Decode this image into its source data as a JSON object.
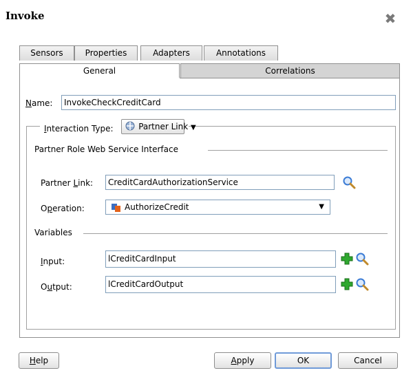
{
  "window": {
    "title": "Invoke",
    "close_icon": "close-icon"
  },
  "tabs": {
    "back": [
      {
        "label": "Sensors"
      },
      {
        "label": "Properties"
      },
      {
        "label": "Adapters"
      },
      {
        "label": "Annotations"
      }
    ],
    "front": [
      {
        "label": "General",
        "selected": true
      },
      {
        "label": "Correlations",
        "selected": false
      }
    ]
  },
  "form": {
    "name_label": "Name:",
    "name_label_mnemonic": "N",
    "name_label_rest": "ame:",
    "name_value": "InvokeCheckCreditCard",
    "interaction_label": "Interaction Type:",
    "interaction_label_mnemonic": "I",
    "interaction_label_rest": "nteraction Type:",
    "interaction_value": "Partner Link",
    "partner_role_section": "Partner Role Web Service Interface",
    "partner_link_label": "Partner Link:",
    "partner_link_pre": "Partner ",
    "partner_link_mnemonic": "L",
    "partner_link_rest": "ink:",
    "partner_link_value": "CreditCardAuthorizationService",
    "operation_label": "Operation:",
    "operation_pre": "O",
    "operation_mnemonic": "p",
    "operation_rest": "eration:",
    "operation_value": "AuthorizeCredit",
    "variables_section": "Variables",
    "input_label": "Input:",
    "input_mnemonic": "I",
    "input_rest": "nput:",
    "input_value": "lCreditCardInput",
    "output_label": "Output:",
    "output_pre": "O",
    "output_mnemonic": "u",
    "output_rest": "tput:",
    "output_value": "lCreditCardOutput"
  },
  "buttons": {
    "help": "Help",
    "help_mnemonic": "H",
    "help_rest": "elp",
    "apply": "Apply",
    "apply_mnemonic": "A",
    "apply_rest": "pply",
    "ok": "OK",
    "cancel": "Cancel"
  },
  "colors": {
    "accent_border": "#6f9ad8",
    "add_icon": "#2fa82f",
    "search_icon": "#3a7bd5"
  }
}
